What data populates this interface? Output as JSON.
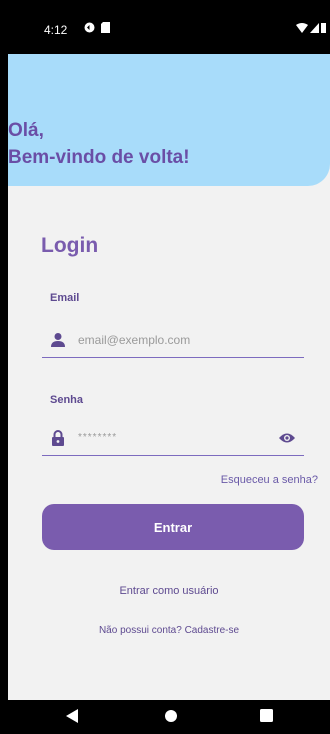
{
  "status_bar": {
    "time": "4:12",
    "left_icons": [
      "sync-icon",
      "sd-card-icon"
    ],
    "right_icons": [
      "wifi-icon",
      "signal-icon",
      "battery-icon"
    ]
  },
  "header": {
    "greeting_line1": "Olá,",
    "greeting_line2": "Bem-vindo de volta!",
    "background_color": "#a8dcfa"
  },
  "login": {
    "title": "Login",
    "email": {
      "label": "Email",
      "placeholder": "email@exemplo.com",
      "icon": "person-icon"
    },
    "password": {
      "label": "Senha",
      "value": "********",
      "icon": "lock-icon",
      "toggle_icon": "eye-icon"
    },
    "forgot_password": "Esqueceu a senha?",
    "submit_label": "Entrar",
    "guest_link": "Entrar como usuário",
    "signup_link": "Não possui conta? Cadastre-se"
  },
  "nav_bar": {
    "buttons": [
      "back-icon",
      "home-icon",
      "recents-icon"
    ]
  },
  "colors": {
    "accent": "#7a5cae",
    "accent_dark": "#5e4a90",
    "background": "#f2f2f2"
  }
}
